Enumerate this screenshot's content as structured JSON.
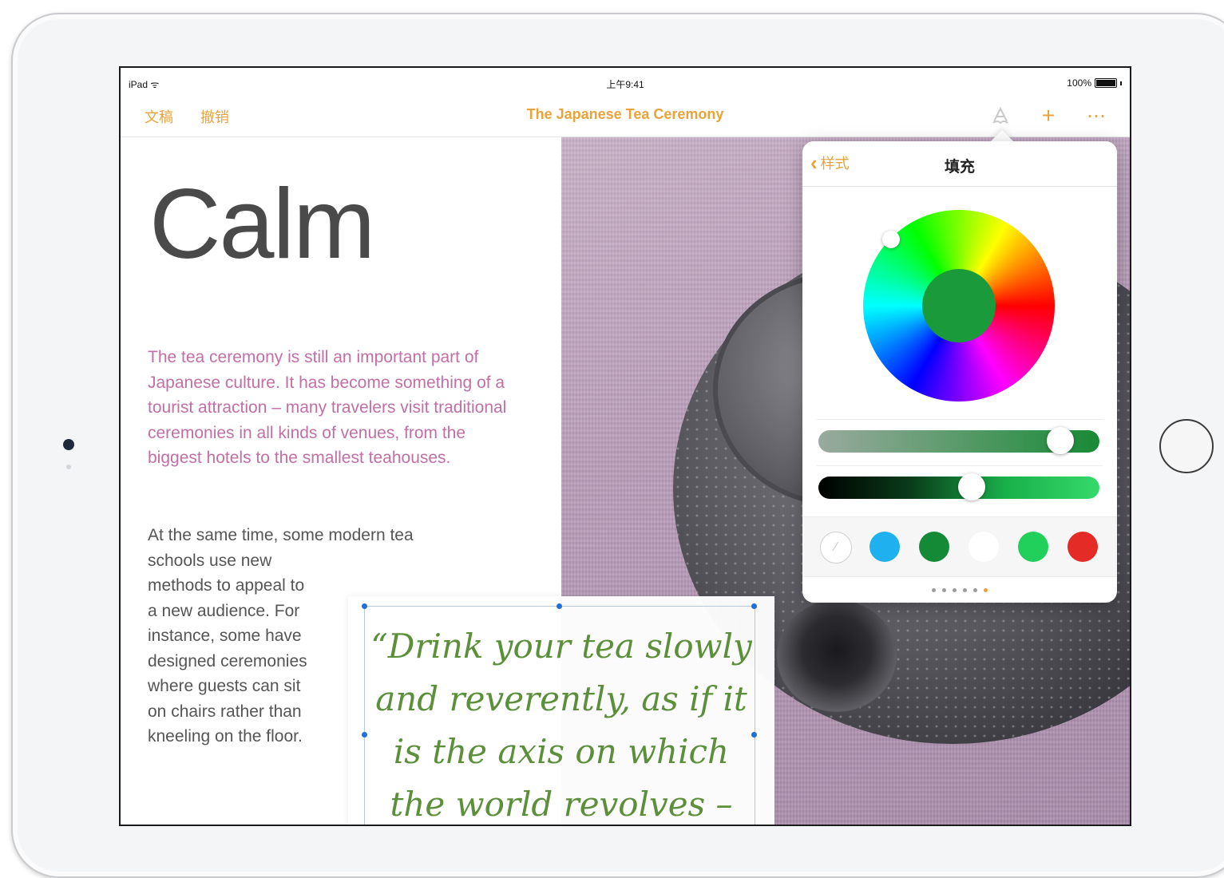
{
  "statusbar": {
    "device": "iPad",
    "time": "上午9:41",
    "battery": "100%"
  },
  "navbar": {
    "documents_label": "文稿",
    "undo_label": "撤销",
    "title": "The Japanese Tea Ceremony",
    "icons": [
      "format-brush-icon",
      "plus-icon",
      "more-icon"
    ]
  },
  "document": {
    "heading": "Calm",
    "intro": "The tea ceremony is still an important part of Japanese culture. It has become something of a tourist attraction – many travelers visit traditional ceremonies in all kinds of venues, from the biggest hotels to the smallest teahouses.",
    "body_wide": "At the same time, some modern tea",
    "body_narrow": "schools use new methods to appeal to a new audience. For instance, some have designed ceremonies where guests can sit on chairs rather than kneeling on the floor.",
    "quote": "“Drink your tea slowly and reverently, as if it is the axis on which the world revolves – slowly,"
  },
  "popover": {
    "back_label": "样式",
    "title": "填充",
    "selected_color": "#1a9a3a",
    "opacity_level": 0.9,
    "brightness_level": 0.55,
    "swatches": [
      {
        "name": "eyedropper",
        "color": "#ffffff"
      },
      {
        "name": "light-blue",
        "color": "#1fb0ef"
      },
      {
        "name": "dark-green",
        "color": "#148a37"
      },
      {
        "name": "white",
        "color": "#ffffff"
      },
      {
        "name": "green",
        "color": "#20d05a"
      },
      {
        "name": "red",
        "color": "#e42b25"
      }
    ],
    "page_count": 6,
    "active_page": 6
  },
  "colors": {
    "accent": "#e8a33b",
    "intro_text": "#c26fa6",
    "quote_text": "#5b8f3a"
  }
}
